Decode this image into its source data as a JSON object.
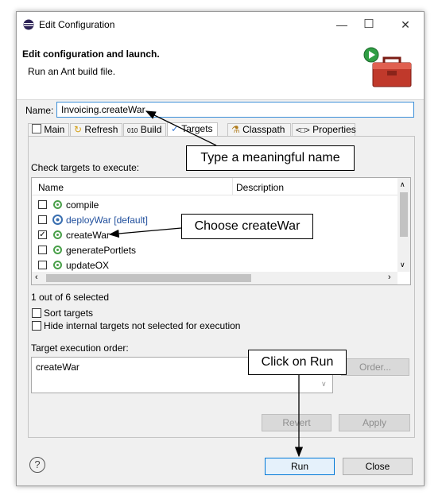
{
  "window": {
    "title": "Edit Configuration",
    "minimize_glyph": "—",
    "maximize_glyph": "☐",
    "close_glyph": "✕"
  },
  "header": {
    "title": "Edit configuration and launch.",
    "subtitle": "Run an Ant build file."
  },
  "name_field": {
    "label": "Name:",
    "value": "Invoicing.createWar"
  },
  "tabs": [
    {
      "label": "Main",
      "icon": "main-tab-icon"
    },
    {
      "label": "Refresh",
      "icon": "refresh-icon"
    },
    {
      "label": "Build",
      "icon": "build-icon"
    },
    {
      "label": "Targets",
      "icon": "targets-icon",
      "selected": true
    },
    {
      "label": "Classpath",
      "icon": "classpath-icon"
    },
    {
      "label": "Properties",
      "icon": "properties-icon"
    }
  ],
  "tabs_overflow": {
    "glyph": "»",
    "count": "3"
  },
  "targets": {
    "section_label": "Check targets to execute:",
    "columns": [
      "Name",
      "Description"
    ],
    "rows": [
      {
        "name": "compile",
        "checked": false,
        "icon": "target-icon",
        "link": false
      },
      {
        "name": "deployWar [default]",
        "checked": false,
        "icon": "default-target-icon",
        "link": true
      },
      {
        "name": "createWar",
        "checked": true,
        "icon": "target-icon",
        "link": false
      },
      {
        "name": "generatePortlets",
        "checked": false,
        "icon": "target-icon",
        "link": false
      },
      {
        "name": "updateOX",
        "checked": false,
        "icon": "target-icon",
        "link": false
      }
    ],
    "selection_count": "1 out of 6 selected",
    "sort_label": "Sort targets",
    "hide_label": "Hide internal targets not selected for execution",
    "order_label": "Target execution order:",
    "order_value": "createWar",
    "order_button": "Order..."
  },
  "buttons": {
    "revert": "Revert",
    "apply": "Apply",
    "run": "Run",
    "close": "Close",
    "help": "?"
  },
  "callouts": {
    "name": "Type a meaningful name",
    "choose": "Choose createWar",
    "run": "Click on Run"
  },
  "colors": {
    "link": "#1f4e9c",
    "accent": "#0078d7",
    "target_green": "#4aa04a"
  }
}
